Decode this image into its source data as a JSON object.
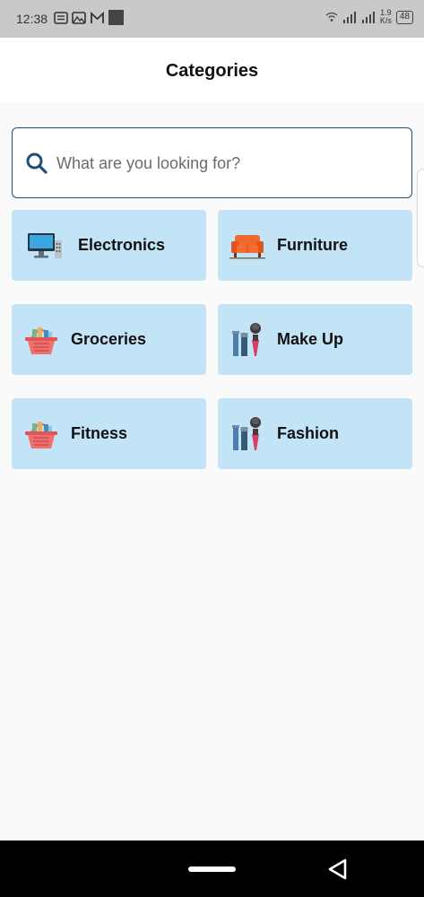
{
  "status_bar": {
    "time": "12:38",
    "net_speed_value": "1.9",
    "net_speed_unit": "K/s",
    "battery": "48"
  },
  "header": {
    "title": "Categories"
  },
  "search": {
    "placeholder": "What are you looking for?"
  },
  "categories": [
    {
      "label": "Electronics",
      "icon": "monitor-icon"
    },
    {
      "label": "Furniture",
      "icon": "sofa-icon"
    },
    {
      "label": "Groceries",
      "icon": "basket-icon"
    },
    {
      "label": "Make Up",
      "icon": "makeup-icon"
    },
    {
      "label": "Fitness",
      "icon": "basket-icon"
    },
    {
      "label": "Fashion",
      "icon": "makeup-icon"
    }
  ],
  "colors": {
    "card_bg": "#c3e4f7",
    "search_border": "#1f4e79",
    "status_bar_bg": "#c9c9c9"
  }
}
